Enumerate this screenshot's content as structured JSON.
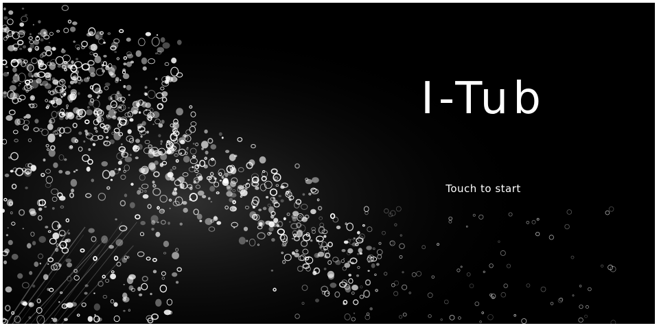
{
  "splash": {
    "title": "I-Tub",
    "prompt": "Touch to start"
  },
  "colors": {
    "background": "#000000",
    "text": "#ffffff",
    "page_border": "#ffffff"
  },
  "background_image": "water-droplets-splash"
}
